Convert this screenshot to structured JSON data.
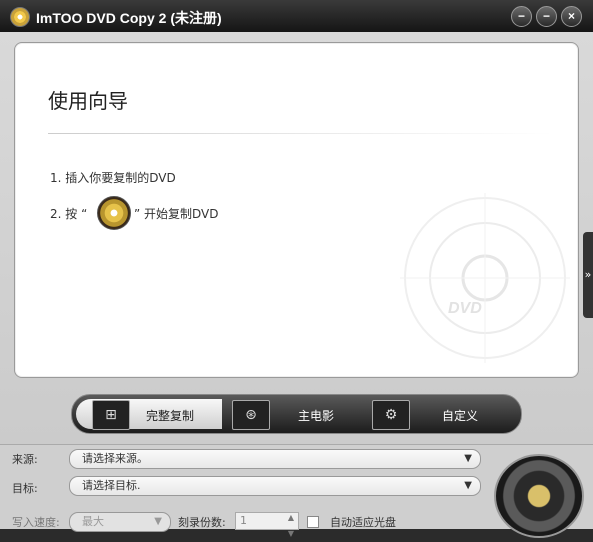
{
  "window": {
    "title": "ImTOO DVD Copy 2 (未注册)"
  },
  "controls": {
    "min": "−",
    "max": "−",
    "close": "×"
  },
  "wizard": {
    "heading": "使用向导",
    "step1": "1. 插入你要复制的DVD",
    "step2_before": "2. 按 “",
    "step2_after": "” 开始复制DVD",
    "watermark_text": "DVD"
  },
  "expand_tab": "»",
  "modes": [
    {
      "label": "完整复制",
      "icon": "full-copy-icon",
      "active": true
    },
    {
      "label": "主电影",
      "icon": "film-reel-icon",
      "active": false
    },
    {
      "label": "自定义",
      "icon": "custom-tools-icon",
      "active": false
    }
  ],
  "source": {
    "label": "来源:",
    "value": "请选择来源。"
  },
  "target": {
    "label": "目标:",
    "value": "请选择目标."
  },
  "speed": {
    "label": "写入速度:",
    "value": "最大"
  },
  "copies": {
    "label": "刻录份数:",
    "value": "1"
  },
  "autofit": {
    "label": "自动适应光盘"
  }
}
